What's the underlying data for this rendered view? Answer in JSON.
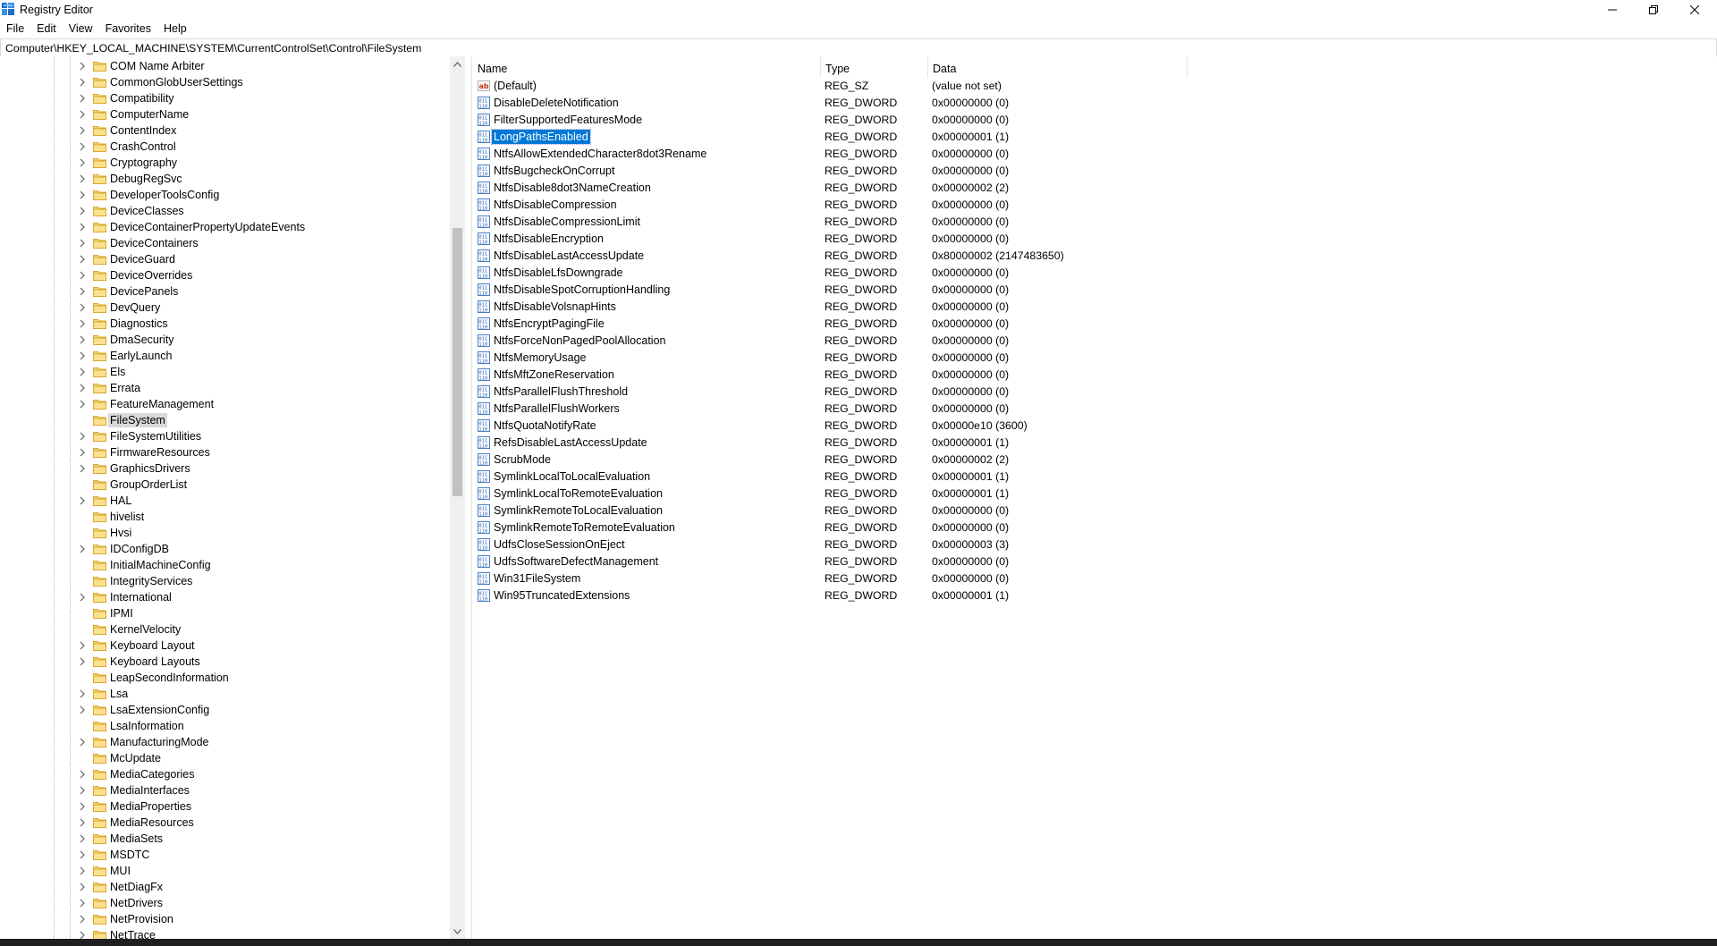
{
  "window": {
    "title": "Registry Editor",
    "app_icon": "regedit-icon"
  },
  "menu": [
    "File",
    "Edit",
    "View",
    "Favorites",
    "Help"
  ],
  "address": {
    "path": "Computer\\HKEY_LOCAL_MACHINE\\SYSTEM\\CurrentControlSet\\Control\\FileSystem"
  },
  "tree": {
    "selected": "FileSystem",
    "items": [
      {
        "label": "COM Name Arbiter",
        "expandable": true
      },
      {
        "label": "CommonGlobUserSettings",
        "expandable": true
      },
      {
        "label": "Compatibility",
        "expandable": true
      },
      {
        "label": "ComputerName",
        "expandable": true
      },
      {
        "label": "ContentIndex",
        "expandable": true
      },
      {
        "label": "CrashControl",
        "expandable": true
      },
      {
        "label": "Cryptography",
        "expandable": true
      },
      {
        "label": "DebugRegSvc",
        "expandable": true
      },
      {
        "label": "DeveloperToolsConfig",
        "expandable": true
      },
      {
        "label": "DeviceClasses",
        "expandable": true
      },
      {
        "label": "DeviceContainerPropertyUpdateEvents",
        "expandable": true
      },
      {
        "label": "DeviceContainers",
        "expandable": true
      },
      {
        "label": "DeviceGuard",
        "expandable": true
      },
      {
        "label": "DeviceOverrides",
        "expandable": true
      },
      {
        "label": "DevicePanels",
        "expandable": true
      },
      {
        "label": "DevQuery",
        "expandable": true
      },
      {
        "label": "Diagnostics",
        "expandable": true
      },
      {
        "label": "DmaSecurity",
        "expandable": true
      },
      {
        "label": "EarlyLaunch",
        "expandable": true
      },
      {
        "label": "Els",
        "expandable": true
      },
      {
        "label": "Errata",
        "expandable": true
      },
      {
        "label": "FeatureManagement",
        "expandable": true
      },
      {
        "label": "FileSystem",
        "expandable": false
      },
      {
        "label": "FileSystemUtilities",
        "expandable": true
      },
      {
        "label": "FirmwareResources",
        "expandable": true
      },
      {
        "label": "GraphicsDrivers",
        "expandable": true
      },
      {
        "label": "GroupOrderList",
        "expandable": false
      },
      {
        "label": "HAL",
        "expandable": true
      },
      {
        "label": "hivelist",
        "expandable": false
      },
      {
        "label": "Hvsi",
        "expandable": false
      },
      {
        "label": "IDConfigDB",
        "expandable": true
      },
      {
        "label": "InitialMachineConfig",
        "expandable": false
      },
      {
        "label": "IntegrityServices",
        "expandable": false
      },
      {
        "label": "International",
        "expandable": true
      },
      {
        "label": "IPMI",
        "expandable": false
      },
      {
        "label": "KernelVelocity",
        "expandable": false
      },
      {
        "label": "Keyboard Layout",
        "expandable": true
      },
      {
        "label": "Keyboard Layouts",
        "expandable": true
      },
      {
        "label": "LeapSecondInformation",
        "expandable": false
      },
      {
        "label": "Lsa",
        "expandable": true
      },
      {
        "label": "LsaExtensionConfig",
        "expandable": true
      },
      {
        "label": "LsaInformation",
        "expandable": false
      },
      {
        "label": "ManufacturingMode",
        "expandable": true
      },
      {
        "label": "McUpdate",
        "expandable": false
      },
      {
        "label": "MediaCategories",
        "expandable": true
      },
      {
        "label": "MediaInterfaces",
        "expandable": true
      },
      {
        "label": "MediaProperties",
        "expandable": true
      },
      {
        "label": "MediaResources",
        "expandable": true
      },
      {
        "label": "MediaSets",
        "expandable": true
      },
      {
        "label": "MSDTC",
        "expandable": true
      },
      {
        "label": "MUI",
        "expandable": true
      },
      {
        "label": "NetDiagFx",
        "expandable": true
      },
      {
        "label": "NetDrivers",
        "expandable": true
      },
      {
        "label": "NetProvision",
        "expandable": true
      },
      {
        "label": "NetTrace",
        "expandable": true
      }
    ]
  },
  "values_header": {
    "name": "Name",
    "type": "Type",
    "data": "Data"
  },
  "values": [
    {
      "name": "(Default)",
      "type": "REG_SZ",
      "data": "(value not set)",
      "icon": "string-value-icon"
    },
    {
      "name": "DisableDeleteNotification",
      "type": "REG_DWORD",
      "data": "0x00000000 (0)",
      "icon": "binary-value-icon"
    },
    {
      "name": "FilterSupportedFeaturesMode",
      "type": "REG_DWORD",
      "data": "0x00000000 (0)",
      "icon": "binary-value-icon"
    },
    {
      "name": "LongPathsEnabled",
      "type": "REG_DWORD",
      "data": "0x00000001 (1)",
      "icon": "binary-value-icon",
      "selected": true
    },
    {
      "name": "NtfsAllowExtendedCharacter8dot3Rename",
      "type": "REG_DWORD",
      "data": "0x00000000 (0)",
      "icon": "binary-value-icon"
    },
    {
      "name": "NtfsBugcheckOnCorrupt",
      "type": "REG_DWORD",
      "data": "0x00000000 (0)",
      "icon": "binary-value-icon"
    },
    {
      "name": "NtfsDisable8dot3NameCreation",
      "type": "REG_DWORD",
      "data": "0x00000002 (2)",
      "icon": "binary-value-icon"
    },
    {
      "name": "NtfsDisableCompression",
      "type": "REG_DWORD",
      "data": "0x00000000 (0)",
      "icon": "binary-value-icon"
    },
    {
      "name": "NtfsDisableCompressionLimit",
      "type": "REG_DWORD",
      "data": "0x00000000 (0)",
      "icon": "binary-value-icon"
    },
    {
      "name": "NtfsDisableEncryption",
      "type": "REG_DWORD",
      "data": "0x00000000 (0)",
      "icon": "binary-value-icon"
    },
    {
      "name": "NtfsDisableLastAccessUpdate",
      "type": "REG_DWORD",
      "data": "0x80000002 (2147483650)",
      "icon": "binary-value-icon"
    },
    {
      "name": "NtfsDisableLfsDowngrade",
      "type": "REG_DWORD",
      "data": "0x00000000 (0)",
      "icon": "binary-value-icon"
    },
    {
      "name": "NtfsDisableSpotCorruptionHandling",
      "type": "REG_DWORD",
      "data": "0x00000000 (0)",
      "icon": "binary-value-icon"
    },
    {
      "name": "NtfsDisableVolsnapHints",
      "type": "REG_DWORD",
      "data": "0x00000000 (0)",
      "icon": "binary-value-icon"
    },
    {
      "name": "NtfsEncryptPagingFile",
      "type": "REG_DWORD",
      "data": "0x00000000 (0)",
      "icon": "binary-value-icon"
    },
    {
      "name": "NtfsForceNonPagedPoolAllocation",
      "type": "REG_DWORD",
      "data": "0x00000000 (0)",
      "icon": "binary-value-icon"
    },
    {
      "name": "NtfsMemoryUsage",
      "type": "REG_DWORD",
      "data": "0x00000000 (0)",
      "icon": "binary-value-icon"
    },
    {
      "name": "NtfsMftZoneReservation",
      "type": "REG_DWORD",
      "data": "0x00000000 (0)",
      "icon": "binary-value-icon"
    },
    {
      "name": "NtfsParallelFlushThreshold",
      "type": "REG_DWORD",
      "data": "0x00000000 (0)",
      "icon": "binary-value-icon"
    },
    {
      "name": "NtfsParallelFlushWorkers",
      "type": "REG_DWORD",
      "data": "0x00000000 (0)",
      "icon": "binary-value-icon"
    },
    {
      "name": "NtfsQuotaNotifyRate",
      "type": "REG_DWORD",
      "data": "0x00000e10 (3600)",
      "icon": "binary-value-icon"
    },
    {
      "name": "RefsDisableLastAccessUpdate",
      "type": "REG_DWORD",
      "data": "0x00000001 (1)",
      "icon": "binary-value-icon"
    },
    {
      "name": "ScrubMode",
      "type": "REG_DWORD",
      "data": "0x00000002 (2)",
      "icon": "binary-value-icon"
    },
    {
      "name": "SymlinkLocalToLocalEvaluation",
      "type": "REG_DWORD",
      "data": "0x00000001 (1)",
      "icon": "binary-value-icon"
    },
    {
      "name": "SymlinkLocalToRemoteEvaluation",
      "type": "REG_DWORD",
      "data": "0x00000001 (1)",
      "icon": "binary-value-icon"
    },
    {
      "name": "SymlinkRemoteToLocalEvaluation",
      "type": "REG_DWORD",
      "data": "0x00000000 (0)",
      "icon": "binary-value-icon"
    },
    {
      "name": "SymlinkRemoteToRemoteEvaluation",
      "type": "REG_DWORD",
      "data": "0x00000000 (0)",
      "icon": "binary-value-icon"
    },
    {
      "name": "UdfsCloseSessionOnEject",
      "type": "REG_DWORD",
      "data": "0x00000003 (3)",
      "icon": "binary-value-icon"
    },
    {
      "name": "UdfsSoftwareDefectManagement",
      "type": "REG_DWORD",
      "data": "0x00000000 (0)",
      "icon": "binary-value-icon"
    },
    {
      "name": "Win31FileSystem",
      "type": "REG_DWORD",
      "data": "0x00000000 (0)",
      "icon": "binary-value-icon"
    },
    {
      "name": "Win95TruncatedExtensions",
      "type": "REG_DWORD",
      "data": "0x00000001 (1)",
      "icon": "binary-value-icon"
    }
  ],
  "colors": {
    "selection": "#0078d7",
    "tree_selection": "#d9d9d9",
    "folder": "#f5c85a"
  }
}
